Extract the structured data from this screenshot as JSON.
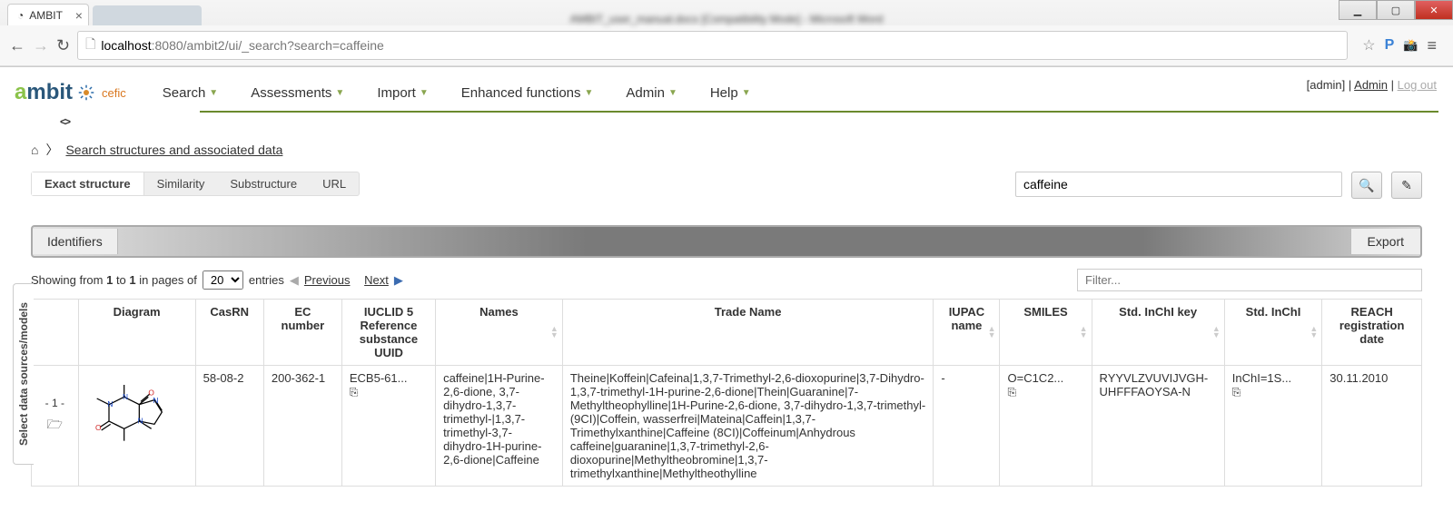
{
  "browser": {
    "tab_title": "AMBIT",
    "blurred_title": "AMBIT_user_manual.docx [Compatibility Mode] - Microsoft Word",
    "url_host": "localhost",
    "url_port": ":8080",
    "url_path": "/ambit2/ui/_search?search=caffeine"
  },
  "logo": {
    "a": "a",
    "mbit": "mbit",
    "cefic": "cefic"
  },
  "menu": {
    "items": [
      "Search",
      "Assessments",
      "Import",
      "Enhanced functions",
      "Admin",
      "Help"
    ]
  },
  "user": {
    "bracket": "[admin]",
    "name": "Admin",
    "logout": "Log out"
  },
  "breadcrumb": {
    "link": "Search structures and associated data"
  },
  "search_tabs": [
    "Exact structure",
    "Similarity",
    "Substructure",
    "URL"
  ],
  "search": {
    "value": "caffeine"
  },
  "section": {
    "title": "Identifiers",
    "export": "Export"
  },
  "pager": {
    "prefix": "Showing from ",
    "from": "1",
    "to_word": " to ",
    "to": "1",
    "in_pages": " in pages of ",
    "page_size": "20",
    "entries": " entries",
    "prev": "Previous",
    "next": "Next",
    "filter_placeholder": "Filter..."
  },
  "table": {
    "headers": [
      "",
      "Diagram",
      "CasRN",
      "EC number",
      "IUCLID 5 Reference substance UUID",
      "Names",
      "Trade Name",
      "IUPAC name",
      "SMILES",
      "Std. InChI key",
      "Std. InChI",
      "REACH registration date"
    ],
    "row": {
      "index": "- 1 -",
      "cas": "58-08-2",
      "ec": "200-362-1",
      "iuclid": "ECB5-61...",
      "names": "caffeine|1H-Purine-2,6-dione, 3,7-dihydro-1,3,7-trimethyl-|1,3,7-trimethyl-3,7-dihydro-1H-purine-2,6-dione|Caffeine",
      "trade": "Theine|Koffein|Cafeina|1,3,7-Trimethyl-2,6-dioxopurine|3,7-Dihydro-1,3,7-trimethyl-1H-purine-2,6-dione|Thein|Guaranine|7-Methyltheophylline|1H-Purine-2,6-dione, 3,7-dihydro-1,3,7-trimethyl- (9CI)|Coffein, wasserfrei|Mateina|Caffein|1,3,7-Trimethylxanthine|Caffeine (8CI)|Coffeinum|Anhydrous caffeine|guaranine|1,3,7-trimethyl-2,6-dioxopurine|Methyltheobromine|1,3,7-trimethylxanthine|Methyltheothylline",
      "iupac": "-",
      "smiles": "O=C1C2...",
      "inchikey": "RYYVLZVUVIJVGH-UHFFFAOYSA-N",
      "inchi": "InChI=1S...",
      "reach": "30.11.2010"
    }
  },
  "side_tab": "Select data sources/models"
}
